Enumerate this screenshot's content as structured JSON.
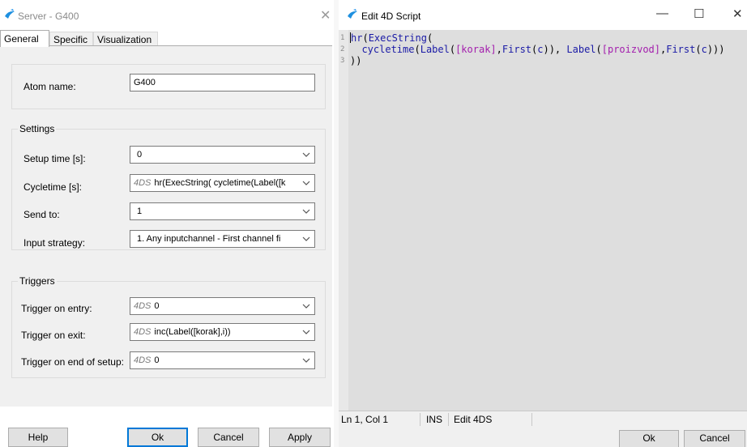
{
  "left_dialog": {
    "title": "Server - G400",
    "tabs": [
      {
        "label": "General"
      },
      {
        "label": "Specific"
      },
      {
        "label": "Visualization"
      }
    ],
    "atom_name": {
      "label": "Atom name:",
      "value": "G400"
    },
    "settings": {
      "legend": "Settings",
      "rows": [
        {
          "label": "Setup time [s]:",
          "tag": "",
          "value": "0"
        },
        {
          "label": "Cycletime [s]:",
          "tag": "4DS",
          "value": "hr(ExecString(  cycletime(Label([k"
        },
        {
          "label": "Send to:",
          "tag": "",
          "value": "1"
        },
        {
          "label": "Input strategy:",
          "tag": "",
          "value": "1. Any inputchannel -  First channel fi"
        }
      ]
    },
    "triggers": {
      "legend": "Triggers",
      "rows": [
        {
          "label": "Trigger on entry:",
          "tag": "4DS",
          "value": "0"
        },
        {
          "label": "Trigger on exit:",
          "tag": "4DS",
          "value": "inc(Label([korak],i))"
        },
        {
          "label": "Trigger on end of setup:",
          "tag": "4DS",
          "value": "0"
        }
      ]
    },
    "buttons": {
      "help": "Help",
      "ok": "Ok",
      "cancel": "Cancel",
      "apply": "Apply"
    }
  },
  "right_window": {
    "title": "Edit 4D Script",
    "controls": {
      "minimize": "—",
      "maximize": "☐",
      "close": "✕"
    },
    "code_lines": [
      {
        "num": "1",
        "text": "hr(ExecString("
      },
      {
        "num": "2",
        "text": "  cycletime(Label([korak],First(c)), Label([proizvod],First(c)))"
      },
      {
        "num": "3",
        "text": "))"
      }
    ],
    "status": {
      "position": "Ln 1, Col 1",
      "mode": "INS",
      "context": "Edit 4DS"
    },
    "buttons": {
      "ok": "Ok",
      "cancel": "Cancel"
    }
  },
  "colors": {
    "accent": "#0078d7",
    "keyword": "#1a1aa6",
    "field_ref": "#a31dad",
    "editor_bg": "#dedede"
  }
}
